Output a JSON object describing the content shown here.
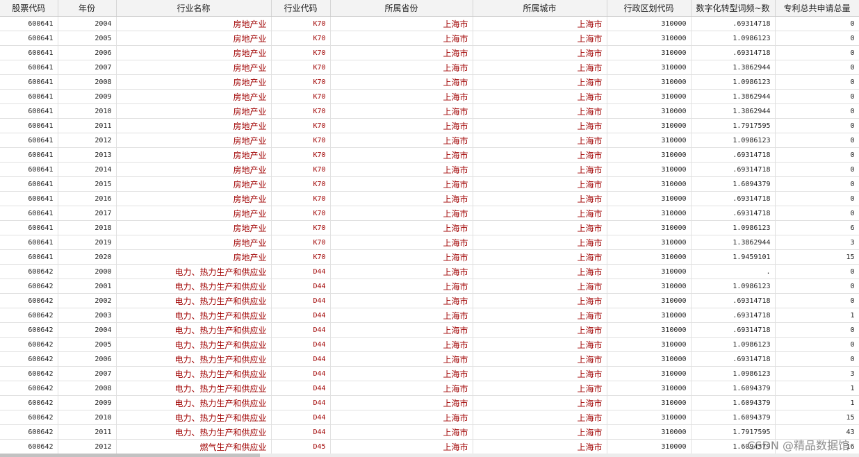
{
  "table": {
    "columns": [
      "股票代码",
      "年份",
      "行业名称",
      "行业代码",
      "所属省份",
      "所属城市",
      "行政区划代码",
      "数字化转型词频~数",
      "专利总共申请总量"
    ],
    "rows": [
      [
        "600641",
        "2004",
        "房地产业",
        "K70",
        "上海市",
        "上海市",
        "310000",
        ".69314718",
        "0"
      ],
      [
        "600641",
        "2005",
        "房地产业",
        "K70",
        "上海市",
        "上海市",
        "310000",
        "1.0986123",
        "0"
      ],
      [
        "600641",
        "2006",
        "房地产业",
        "K70",
        "上海市",
        "上海市",
        "310000",
        ".69314718",
        "0"
      ],
      [
        "600641",
        "2007",
        "房地产业",
        "K70",
        "上海市",
        "上海市",
        "310000",
        "1.3862944",
        "0"
      ],
      [
        "600641",
        "2008",
        "房地产业",
        "K70",
        "上海市",
        "上海市",
        "310000",
        "1.0986123",
        "0"
      ],
      [
        "600641",
        "2009",
        "房地产业",
        "K70",
        "上海市",
        "上海市",
        "310000",
        "1.3862944",
        "0"
      ],
      [
        "600641",
        "2010",
        "房地产业",
        "K70",
        "上海市",
        "上海市",
        "310000",
        "1.3862944",
        "0"
      ],
      [
        "600641",
        "2011",
        "房地产业",
        "K70",
        "上海市",
        "上海市",
        "310000",
        "1.7917595",
        "0"
      ],
      [
        "600641",
        "2012",
        "房地产业",
        "K70",
        "上海市",
        "上海市",
        "310000",
        "1.0986123",
        "0"
      ],
      [
        "600641",
        "2013",
        "房地产业",
        "K70",
        "上海市",
        "上海市",
        "310000",
        ".69314718",
        "0"
      ],
      [
        "600641",
        "2014",
        "房地产业",
        "K70",
        "上海市",
        "上海市",
        "310000",
        ".69314718",
        "0"
      ],
      [
        "600641",
        "2015",
        "房地产业",
        "K70",
        "上海市",
        "上海市",
        "310000",
        "1.6094379",
        "0"
      ],
      [
        "600641",
        "2016",
        "房地产业",
        "K70",
        "上海市",
        "上海市",
        "310000",
        ".69314718",
        "0"
      ],
      [
        "600641",
        "2017",
        "房地产业",
        "K70",
        "上海市",
        "上海市",
        "310000",
        ".69314718",
        "0"
      ],
      [
        "600641",
        "2018",
        "房地产业",
        "K70",
        "上海市",
        "上海市",
        "310000",
        "1.0986123",
        "6"
      ],
      [
        "600641",
        "2019",
        "房地产业",
        "K70",
        "上海市",
        "上海市",
        "310000",
        "1.3862944",
        "3"
      ],
      [
        "600641",
        "2020",
        "房地产业",
        "K70",
        "上海市",
        "上海市",
        "310000",
        "1.9459101",
        "15"
      ],
      [
        "600642",
        "2000",
        "电力、热力生产和供应业",
        "D44",
        "上海市",
        "上海市",
        "310000",
        ".",
        "0"
      ],
      [
        "600642",
        "2001",
        "电力、热力生产和供应业",
        "D44",
        "上海市",
        "上海市",
        "310000",
        "1.0986123",
        "0"
      ],
      [
        "600642",
        "2002",
        "电力、热力生产和供应业",
        "D44",
        "上海市",
        "上海市",
        "310000",
        ".69314718",
        "0"
      ],
      [
        "600642",
        "2003",
        "电力、热力生产和供应业",
        "D44",
        "上海市",
        "上海市",
        "310000",
        ".69314718",
        "1"
      ],
      [
        "600642",
        "2004",
        "电力、热力生产和供应业",
        "D44",
        "上海市",
        "上海市",
        "310000",
        ".69314718",
        "0"
      ],
      [
        "600642",
        "2005",
        "电力、热力生产和供应业",
        "D44",
        "上海市",
        "上海市",
        "310000",
        "1.0986123",
        "0"
      ],
      [
        "600642",
        "2006",
        "电力、热力生产和供应业",
        "D44",
        "上海市",
        "上海市",
        "310000",
        ".69314718",
        "0"
      ],
      [
        "600642",
        "2007",
        "电力、热力生产和供应业",
        "D44",
        "上海市",
        "上海市",
        "310000",
        "1.0986123",
        "3"
      ],
      [
        "600642",
        "2008",
        "电力、热力生产和供应业",
        "D44",
        "上海市",
        "上海市",
        "310000",
        "1.6094379",
        "1"
      ],
      [
        "600642",
        "2009",
        "电力、热力生产和供应业",
        "D44",
        "上海市",
        "上海市",
        "310000",
        "1.6094379",
        "1"
      ],
      [
        "600642",
        "2010",
        "电力、热力生产和供应业",
        "D44",
        "上海市",
        "上海市",
        "310000",
        "1.6094379",
        "15"
      ],
      [
        "600642",
        "2011",
        "电力、热力生产和供应业",
        "D44",
        "上海市",
        "上海市",
        "310000",
        "1.7917595",
        "43"
      ],
      [
        "600642",
        "2012",
        "燃气生产和供应业",
        "D45",
        "上海市",
        "上海市",
        "310000",
        "1.6094379",
        "16"
      ]
    ]
  },
  "watermark": "CSDN @精品数据馆",
  "colors": {
    "string_cell": "#a00000",
    "numeric_cell": "#222222",
    "header_bg": "#f3f3f3"
  }
}
